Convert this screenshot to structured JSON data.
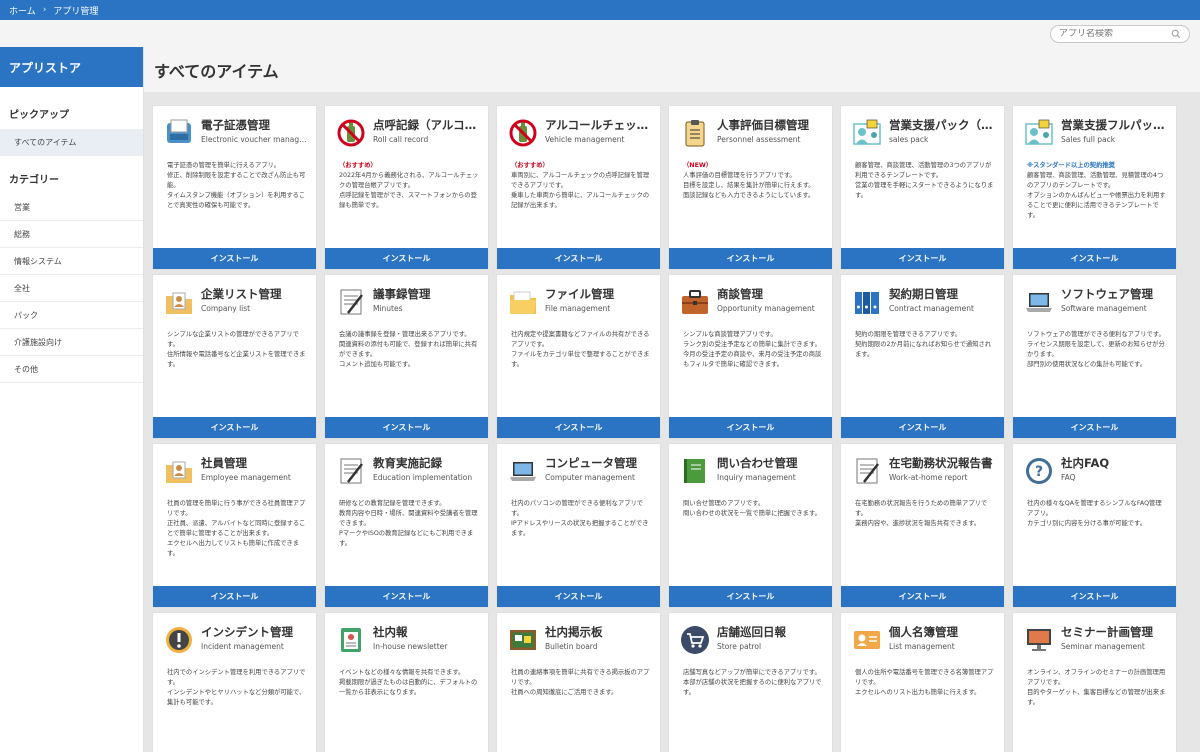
{
  "breadcrumb": {
    "home": "ホーム",
    "sep": "›",
    "current": "アプリ管理"
  },
  "search": {
    "placeholder": "アプリ名検索"
  },
  "sidebar": {
    "title": "アプリストア",
    "pickup_label": "ピックアップ",
    "pickup_items": [
      "すべてのアイテム"
    ],
    "category_label": "カテゴリー",
    "category_items": [
      "営業",
      "総務",
      "情報システム",
      "全社",
      "パック",
      "介護施設向け",
      "その他"
    ]
  },
  "page_title": "すべてのアイテム",
  "install_label": "インストール",
  "cards": [
    {
      "icon": "scanner-icon",
      "title": "電子証憑管理",
      "sub": "Electronic voucher manage…",
      "tag": "",
      "body": "電子証憑の管理を簡単に行えるアプリ。\n修正、削除制限を設定することで改ざん防止も可能。\nタイムスタンプ機能（オプション）を利用することで真実性の確保も可能です。"
    },
    {
      "icon": "no-drinking-icon",
      "title": "点呼記録（アルコ…",
      "sub": "Roll call record",
      "tag": "（おすすめ）",
      "body": "2022年4月から義務化される、アルコールチェックの管理台帳アプリです。\n点呼記録を管理ができ、スマートフォンからの登録も簡単です。"
    },
    {
      "icon": "no-drinking-icon",
      "title": "アルコールチェッ…",
      "sub": "Vehicle management",
      "tag": "（おすすめ）",
      "body": "車両別に、アルコールチェックの点呼記録を管理できるアプリです。\n乗車した車両から簡単に、アルコールチェックの記録が出来ます。"
    },
    {
      "icon": "clipboard-icon",
      "title": "人事評価目標管理",
      "sub": "Personnel assessment",
      "tag": "（NEW）",
      "body": "人事評価の目標管理を行うアプリです。\n目標を設定し、結果を集計が簡単に行えます。\n面談記録なども入力できるようにしています。"
    },
    {
      "icon": "people-chart-icon",
      "title": "営業支援パック（…",
      "sub": "sales pack",
      "tag": "",
      "body": "顧客管理、商談管理、活動管理の3つのアプリが利用できるテンプレートです。\n営業の管理を手軽にスタートできるようになります。"
    },
    {
      "icon": "people-chart-icon",
      "title": "営業支援フルパッ…",
      "sub": "Sales full pack",
      "tag": "※スタンダード以上の契約推奨",
      "tagBlue": true,
      "body": "顧客管理、商談管理、活動管理、見積管理の4つのアプリのテンプレートです。\nオプションのかんばんビューや帳票出力を利用することで更に便利に活用できるテンプレートです。"
    },
    {
      "icon": "company-folder-icon",
      "title": "企業リスト管理",
      "sub": "Company list",
      "tag": "",
      "body": "シンプルな企業リストの管理ができるアプリです。\n住所情報や電話番号など企業リストを管理できます。"
    },
    {
      "icon": "notepad-icon",
      "title": "議事録管理",
      "sub": "Minutes",
      "tag": "",
      "body": "会議の議事録を登録・管理出来るアプリです。\n関連資料の添付も可能で、登録すれば簡単に共有ができます。\nコメント追加も可能です。"
    },
    {
      "icon": "folder-icon",
      "title": "ファイル管理",
      "sub": "File management",
      "tag": "",
      "body": "社内規定や提案書籍などファイルの共有ができるアプリです。\nファイルをカテゴリ単位で整理することができます。"
    },
    {
      "icon": "briefcase-icon",
      "title": "商談管理",
      "sub": "Opportunity management",
      "tag": "",
      "body": "シンプルな商談管理アプリです。\nランク別の受注予定などの簡単に集計できます。\n今月の受注予定の商談や、来月の受注予定の商談もフィルタで簡単に確認できます。"
    },
    {
      "icon": "binders-icon",
      "title": "契約期日管理",
      "sub": "Contract management",
      "tag": "",
      "body": "契約の期限を管理できるアプリです。\n契約期限の2か月前になればお知らせで通知されます。"
    },
    {
      "icon": "laptop-icon",
      "title": "ソフトウェア管理",
      "sub": "Software management",
      "tag": "",
      "body": "ソフトウェアの管理ができる便利なアプリです。\nライセンス期限を設定して、更新のお知らせが分かります。\n部門別の使用状況などの集計も可能です。"
    },
    {
      "icon": "company-folder-icon",
      "title": "社員管理",
      "sub": "Employee management",
      "tag": "",
      "body": "社員の管理を簡単に行う事ができる社員管理アプリです。\n正社員、派遣、アルバイトなど同時に登録することで簡単に管理することが出来ます。\nエクセルへ出力してリストも簡単に作成できます。"
    },
    {
      "icon": "notepad-icon",
      "title": "教育実施記録",
      "sub": "Education implementation",
      "tag": "",
      "body": "研修などの教育記録を管理できます。\n教育内容や日時・場所、関連資料や受講者を管理できます。\nPマークやISOの教育記録などにもご利用できます。"
    },
    {
      "icon": "laptop-icon",
      "title": "コンピュータ管理",
      "sub": "Computer management",
      "tag": "",
      "body": "社内のパソコンの管理ができる便利なアプリです。\nIPアドレスやリースの状況も把握することができます。"
    },
    {
      "icon": "notebook-icon",
      "title": "問い合わせ管理",
      "sub": "Inquiry management",
      "tag": "",
      "body": "問い合せ管理のアプリです。\n問い合わせの状況を一覧で簡単に把握できます。"
    },
    {
      "icon": "notepad-icon",
      "title": "在宅勤務状況報告書",
      "sub": "Work-at-home report",
      "tag": "",
      "body": "在宅勤務の状況報告を行うための簡単アプリです。\n業務内容や、進捗状況を報告共有できます。"
    },
    {
      "icon": "question-icon",
      "title": "社内FAQ",
      "sub": "FAQ",
      "tag": "",
      "body": "社内の様々なQAを管理するシンプルなFAQ管理アプリ。\nカテゴリ別に内容を分ける事が可能です。"
    },
    {
      "icon": "alert-icon",
      "title": "インシデント管理",
      "sub": "Incident management",
      "tag": "",
      "body": "社内でのインシデント管理を利用できるアプリです。\nインシデントやヒヤリハットなど分類が可能で、集計も可能です。"
    },
    {
      "icon": "newsletter-icon",
      "title": "社内報",
      "sub": "In-house newsletter",
      "tag": "",
      "body": "イベントなどの様々な情報を共有できます。\n掲載期限が過ぎたものは自動的に、デフォルトの一覧から非表示になります。"
    },
    {
      "icon": "bulletin-board-icon",
      "title": "社内掲示板",
      "sub": "Bulletin board",
      "tag": "",
      "body": "社員の連絡事項を簡単に共有できる掲示板のアプリです。\n社員への周知徹底にご活用できます。"
    },
    {
      "icon": "cart-icon",
      "title": "店舗巡回日報",
      "sub": "Store patrol",
      "tag": "",
      "body": "店舗写真などアップが簡単にできるアプリです。\n本部が店舗の状況を把握するのに便利なアプリです。"
    },
    {
      "icon": "contact-card-icon",
      "title": "個人名簿管理",
      "sub": "List management",
      "tag": "",
      "body": "個人の住所や電話番号を管理できる名簿管理アプリです。\nエクセルへのリスト出力も簡単に行えます。"
    },
    {
      "icon": "monitor-icon",
      "title": "セミナー計画管理",
      "sub": "Seminar management",
      "tag": "",
      "body": "オンライン、オフラインのセミナーの計画管理用アプリです。\n目的やターゲット、集客目標などの管理が出来ます。"
    }
  ]
}
